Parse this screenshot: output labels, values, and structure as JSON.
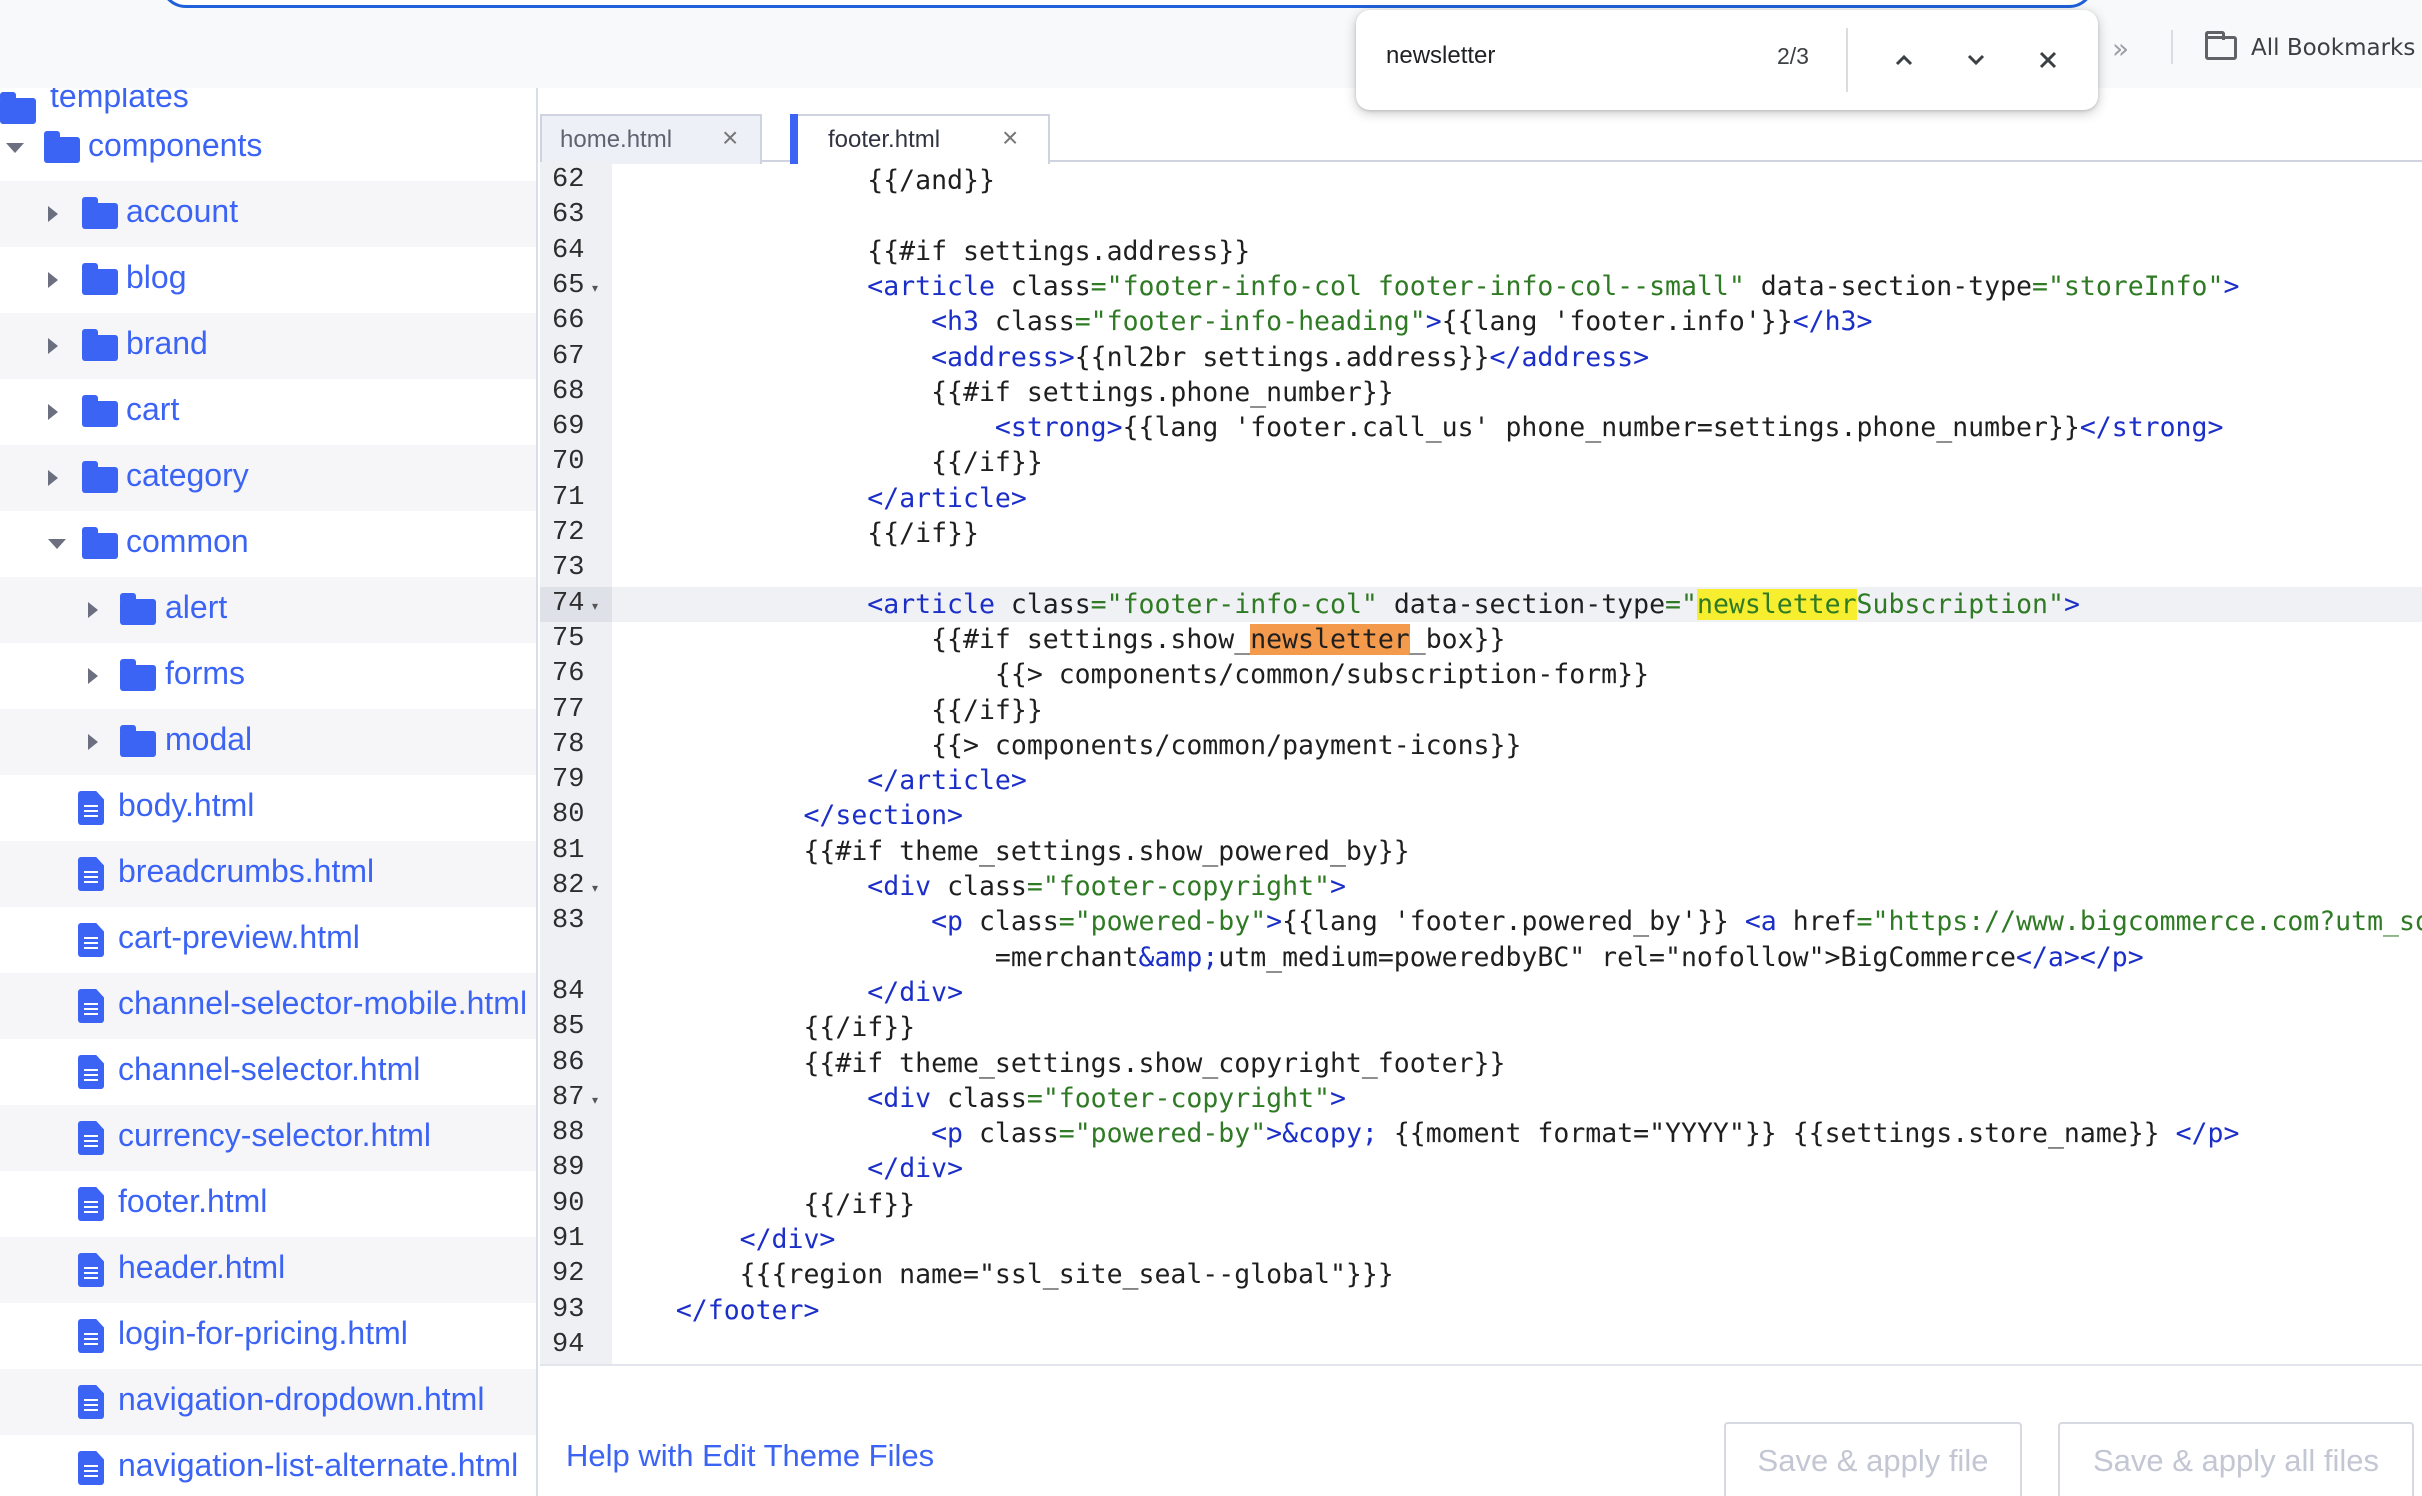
{
  "browser": {
    "bookmarks_chevron": "»",
    "all_bookmarks_label": "All Bookmarks"
  },
  "find": {
    "query": "newsletter",
    "count": "2/3"
  },
  "sidebar": {
    "partial_top_label": "templates",
    "items": [
      {
        "label": "components",
        "type": "folder",
        "expanded": true
      },
      {
        "label": "account",
        "type": "folder",
        "expanded": false
      },
      {
        "label": "blog",
        "type": "folder",
        "expanded": false
      },
      {
        "label": "brand",
        "type": "folder",
        "expanded": false
      },
      {
        "label": "cart",
        "type": "folder",
        "expanded": false
      },
      {
        "label": "category",
        "type": "folder",
        "expanded": false
      },
      {
        "label": "common",
        "type": "folder",
        "expanded": true
      },
      {
        "label": "alert",
        "type": "folder",
        "expanded": false
      },
      {
        "label": "forms",
        "type": "folder",
        "expanded": false
      },
      {
        "label": "modal",
        "type": "folder",
        "expanded": false
      },
      {
        "label": "body.html",
        "type": "file"
      },
      {
        "label": "breadcrumbs.html",
        "type": "file"
      },
      {
        "label": "cart-preview.html",
        "type": "file"
      },
      {
        "label": "channel-selector-mobile.html",
        "type": "file"
      },
      {
        "label": "channel-selector.html",
        "type": "file"
      },
      {
        "label": "currency-selector.html",
        "type": "file"
      },
      {
        "label": "footer.html",
        "type": "file"
      },
      {
        "label": "header.html",
        "type": "file"
      },
      {
        "label": "login-for-pricing.html",
        "type": "file"
      },
      {
        "label": "navigation-dropdown.html",
        "type": "file"
      },
      {
        "label": "navigation-list-alternate.html",
        "type": "file"
      }
    ]
  },
  "editor": {
    "tabs": [
      {
        "label": "home.html",
        "active": false
      },
      {
        "label": "footer.html",
        "active": true
      }
    ],
    "current_line": "74",
    "lines": [
      {
        "n": "62",
        "text": "                {{/and}}"
      },
      {
        "n": "63",
        "text": ""
      },
      {
        "n": "64",
        "text": "                {{#if settings.address}}"
      },
      {
        "n": "65",
        "text": "                <article class=\"footer-info-col footer-info-col--small\" data-section-type=\"storeInfo\">",
        "fold": true
      },
      {
        "n": "66",
        "text": "                    <h3 class=\"footer-info-heading\">{{lang 'footer.info'}}</h3>"
      },
      {
        "n": "67",
        "text": "                    <address>{{nl2br settings.address}}</address>"
      },
      {
        "n": "68",
        "text": "                    {{#if settings.phone_number}}"
      },
      {
        "n": "69",
        "text": "                        <strong>{{lang 'footer.call_us' phone_number=settings.phone_number}}</strong>"
      },
      {
        "n": "70",
        "text": "                    {{/if}}"
      },
      {
        "n": "71",
        "text": "                </article>"
      },
      {
        "n": "72",
        "text": "                {{/if}}"
      },
      {
        "n": "73",
        "text": ""
      },
      {
        "n": "74",
        "text": "                <article class=\"footer-info-col\" data-section-type=\"newsletterSubscription\">",
        "fold": true
      },
      {
        "n": "75",
        "text": "                    {{#if settings.show_newsletter_box}}"
      },
      {
        "n": "76",
        "text": "                        {{> components/common/subscription-form}}"
      },
      {
        "n": "77",
        "text": "                    {{/if}}"
      },
      {
        "n": "78",
        "text": "                    {{> components/common/payment-icons}}"
      },
      {
        "n": "79",
        "text": "                </article>"
      },
      {
        "n": "80",
        "text": "            </section>"
      },
      {
        "n": "81",
        "text": "            {{#if theme_settings.show_powered_by}}"
      },
      {
        "n": "82",
        "text": "                <div class=\"footer-copyright\">",
        "fold": true
      },
      {
        "n": "83",
        "text": "                    <p class=\"powered-by\">{{lang 'footer.powered_by'}} <a href=\"https://www.bigcommerce.com?utm_source"
      },
      {
        "n": "",
        "text": "                        =merchant&amp;utm_medium=poweredbyBC\" rel=\"nofollow\">BigCommerce</a></p>"
      },
      {
        "n": "84",
        "text": "                </div>"
      },
      {
        "n": "85",
        "text": "            {{/if}}"
      },
      {
        "n": "86",
        "text": "            {{#if theme_settings.show_copyright_footer}}"
      },
      {
        "n": "87",
        "text": "                <div class=\"footer-copyright\">",
        "fold": true
      },
      {
        "n": "88",
        "text": "                    <p class=\"powered-by\">&copy; {{moment format=\"YYYY\"}} {{settings.store_name}} </p>"
      },
      {
        "n": "89",
        "text": "                </div>"
      },
      {
        "n": "90",
        "text": "            {{/if}}"
      },
      {
        "n": "91",
        "text": "        </div>"
      },
      {
        "n": "92",
        "text": "        {{{region name=\"ssl_site_seal--global\"}}}"
      },
      {
        "n": "93",
        "text": "    </footer>"
      },
      {
        "n": "94",
        "text": ""
      }
    ]
  },
  "footer": {
    "help_link": "Help with Edit Theme Files",
    "save_file": "Save & apply file",
    "save_all": "Save & apply all files"
  },
  "colors": {
    "accent": "#3c64f4",
    "tag": "#1b2fc8",
    "string": "#2f7a24",
    "match_current": "#f39a4d",
    "match": "#f7ee2f"
  }
}
